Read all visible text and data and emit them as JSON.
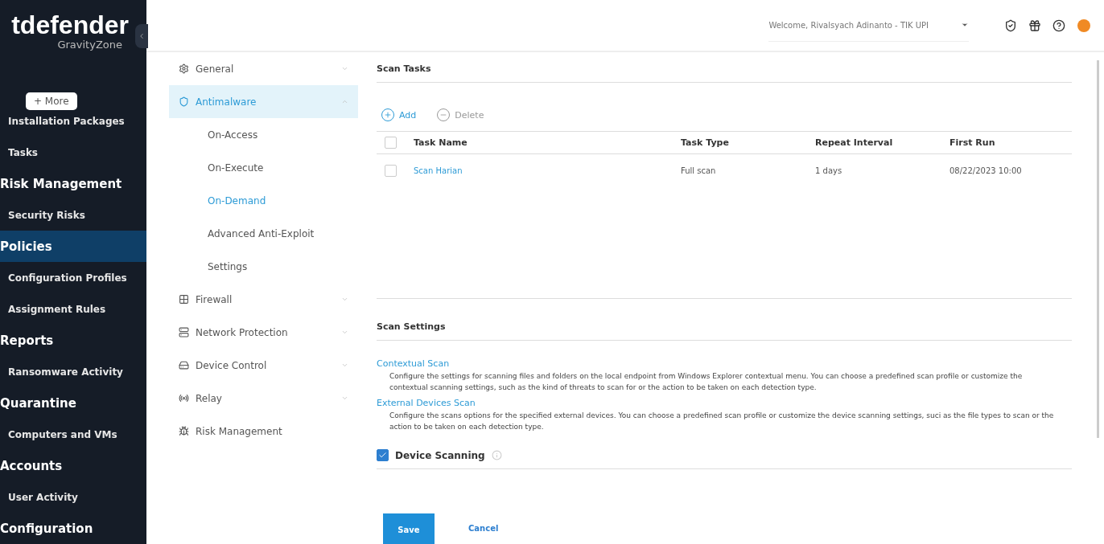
{
  "logo": {
    "brand": "tdefender",
    "product": "GravityZone"
  },
  "more_button": "+ More",
  "sidebar": {
    "items": [
      {
        "label": "Installation Packages",
        "kind": "sub",
        "selected": false
      },
      {
        "label": "Tasks",
        "kind": "sub",
        "selected": false
      },
      {
        "label": "Risk Management",
        "kind": "section",
        "selected": false
      },
      {
        "label": "Security Risks",
        "kind": "sub",
        "selected": false
      },
      {
        "label": "Policies",
        "kind": "section",
        "selected": true
      },
      {
        "label": "Configuration Profiles",
        "kind": "sub",
        "selected": false
      },
      {
        "label": "Assignment Rules",
        "kind": "sub",
        "selected": false
      },
      {
        "label": "Reports",
        "kind": "section",
        "selected": false
      },
      {
        "label": "Ransomware Activity",
        "kind": "sub",
        "selected": false
      },
      {
        "label": "Quarantine",
        "kind": "section",
        "selected": false
      },
      {
        "label": "Computers and VMs",
        "kind": "sub",
        "selected": false
      },
      {
        "label": "Accounts",
        "kind": "section",
        "selected": false
      },
      {
        "label": "User Activity",
        "kind": "sub",
        "selected": false
      },
      {
        "label": "Configuration",
        "kind": "section",
        "selected": false
      }
    ]
  },
  "topbar": {
    "welcome": "Welcome, Rivalsyach Adinanto - TIK UPI"
  },
  "policy_menu": [
    {
      "label": "General",
      "expanded": false,
      "selected": false
    },
    {
      "label": "Antimalware",
      "expanded": true,
      "selected": true,
      "children": [
        {
          "label": "On-Access",
          "selected": false
        },
        {
          "label": "On-Execute",
          "selected": false
        },
        {
          "label": "On-Demand",
          "selected": true
        },
        {
          "label": "Advanced Anti-Exploit",
          "selected": false
        },
        {
          "label": "Settings",
          "selected": false
        }
      ]
    },
    {
      "label": "Firewall",
      "expanded": false,
      "selected": false
    },
    {
      "label": "Network Protection",
      "expanded": false,
      "selected": false
    },
    {
      "label": "Device Control",
      "expanded": false,
      "selected": false
    },
    {
      "label": "Relay",
      "expanded": false,
      "selected": false
    },
    {
      "label": "Risk Management",
      "selected": false
    }
  ],
  "scan_tasks": {
    "title": "Scan Tasks",
    "all_checked": false,
    "actions": [
      {
        "label": "Add",
        "disabled": false
      },
      {
        "label": "Delete",
        "disabled": true
      }
    ],
    "columns": [
      "Task Name",
      "Task Type",
      "Repeat Interval",
      "First Run"
    ],
    "rows": [
      {
        "checked": false,
        "cells": [
          "Scan Harian",
          "Full scan",
          "1 days",
          "08/22/2023 10:00"
        ]
      }
    ]
  },
  "scan_settings": {
    "title": "Scan Settings",
    "sections": [
      {
        "title": "Contextual Scan",
        "text": "Configure the settings for scanning files and folders on the local endpoint from Windows Explorer contextual menu. You can choose a predefined scan profile or customize the contextual scanning settings, such as the kind of threats to scan for or the action to be taken on each detection type."
      },
      {
        "title": "External Devices Scan",
        "text": "Configure the scans options for the specified external devices. You can choose a predefined scan profile or customize the device scanning settings, suci as the file types to scan or the action to be taken on each detection type."
      }
    ],
    "device_scanning": {
      "label": "Device Scanning",
      "checked": true
    }
  },
  "footer": {
    "save": "Save",
    "cancel": "Cancel"
  }
}
